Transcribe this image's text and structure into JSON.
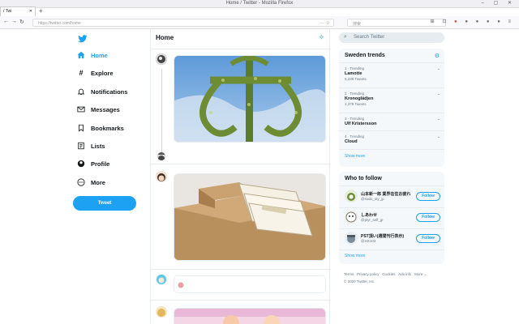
{
  "browser": {
    "window_title": "Home / Twitter - Mozilla Firefox",
    "tab_label": "/ Twi",
    "url": "https://twitter.com/home",
    "search_placeholder": "搜索"
  },
  "nav": {
    "items": [
      {
        "label": "Home",
        "icon": "home-icon"
      },
      {
        "label": "Explore",
        "icon": "hashtag-icon"
      },
      {
        "label": "Notifications",
        "icon": "bell-icon"
      },
      {
        "label": "Messages",
        "icon": "envelope-icon"
      },
      {
        "label": "Bookmarks",
        "icon": "bookmark-icon"
      },
      {
        "label": "Lists",
        "icon": "list-icon"
      },
      {
        "label": "Profile",
        "icon": "person-icon"
      },
      {
        "label": "More",
        "icon": "more-icon"
      }
    ],
    "tweet_button": "Tweet"
  },
  "timeline": {
    "title": "Home"
  },
  "sidebar": {
    "search_placeholder": "Search Twitter",
    "trends_title": "Sweden trends",
    "trends": [
      {
        "meta": "1 · Trending",
        "name": "Lamotte",
        "count": "6,238 Tweets"
      },
      {
        "meta": "2 · Trending",
        "name": "Kronoglädjen",
        "count": "2,379 Tweets"
      },
      {
        "meta": "3 · Trending",
        "name": "Ulf Kristersson",
        "count": ""
      },
      {
        "meta": "4 · Trending",
        "name": "Cloud",
        "count": ""
      }
    ],
    "show_more_trends": "Show more",
    "who_title": "Who to follow",
    "who": [
      {
        "name": "山本新一郎 業界在住お疲れ",
        "handle": "@sudo_sty_jp",
        "button": "Follow"
      },
      {
        "name": "しあわせ",
        "handle": "@plyr_self_jp",
        "button": "Follow"
      },
      {
        "name": "PST頂い(週間刊行表示)",
        "handle": "@HX103",
        "button": "Follow"
      }
    ],
    "show_more_who": "Show more",
    "footer": [
      "Terms",
      "Privacy policy",
      "Cookies",
      "Ads info",
      "More ⌄",
      "© 2020 Twitter, Inc."
    ]
  }
}
